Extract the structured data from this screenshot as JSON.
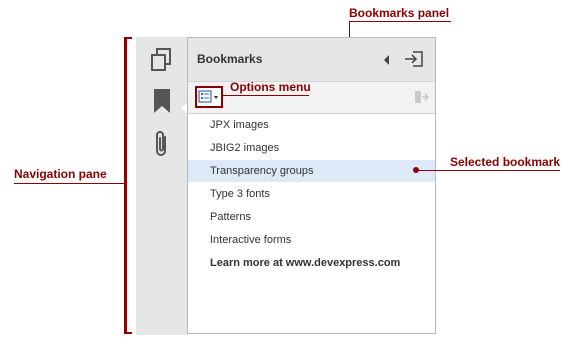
{
  "callouts": {
    "bookmarks_panel": "Bookmarks panel",
    "options_menu": "Options menu",
    "navigation_pane": "Navigation pane",
    "selected_bookmark": "Selected bookmark"
  },
  "nav_icons": [
    "pages-icon",
    "bookmark-icon",
    "attachment-icon"
  ],
  "panel": {
    "title": "Bookmarks"
  },
  "bookmarks": [
    {
      "label": "JPX images",
      "selected": false
    },
    {
      "label": "JBIG2 images",
      "selected": false
    },
    {
      "label": "Transparency groups",
      "selected": true
    },
    {
      "label": "Type 3 fonts",
      "selected": false
    },
    {
      "label": "Patterns",
      "selected": false
    },
    {
      "label": "Interactive forms",
      "selected": false
    }
  ],
  "learn_more": "Learn more at www.devexpress.com",
  "colors": {
    "annotation": "#8b0000",
    "nav_background": "#e6e6e6",
    "selection": "#dde9f6",
    "bookmark_icon": "#555555"
  }
}
